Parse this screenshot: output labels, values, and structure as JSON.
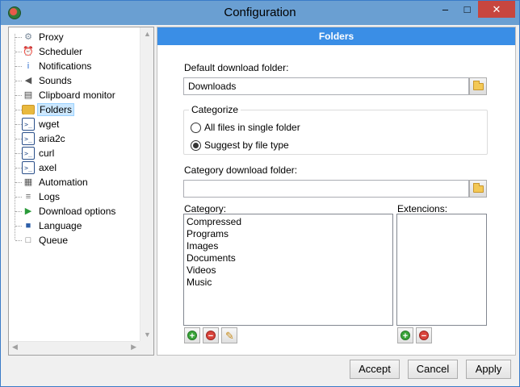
{
  "window": {
    "title": "Configuration",
    "minimize_glyph": "–",
    "maximize_glyph": "□",
    "close_glyph": "✕"
  },
  "tree": {
    "items": [
      {
        "label": "Proxy",
        "icon": "gear-icon",
        "glyph": "⚙",
        "color": "#7a8a9a"
      },
      {
        "label": "Scheduler",
        "icon": "clock-icon",
        "glyph": "⏰",
        "color": "#3a7bc8"
      },
      {
        "label": "Notifications",
        "icon": "info-icon",
        "glyph": "i",
        "color": "#2e6fd0"
      },
      {
        "label": "Sounds",
        "icon": "speaker-icon",
        "glyph": "◀",
        "color": "#555555"
      },
      {
        "label": "Clipboard monitor",
        "icon": "clipboard-icon",
        "glyph": "▤",
        "color": "#444444"
      },
      {
        "label": "Folders",
        "icon": "folder-icon",
        "glyph": "▬",
        "color": "#e9b93e"
      },
      {
        "label": "wget",
        "icon": "console-icon",
        "glyph": ">_",
        "color": "#2a4f8a"
      },
      {
        "label": "aria2c",
        "icon": "console-icon",
        "glyph": ">_",
        "color": "#2a4f8a"
      },
      {
        "label": "curl",
        "icon": "console-icon",
        "glyph": ">_",
        "color": "#2a4f8a"
      },
      {
        "label": "axel",
        "icon": "console-icon",
        "glyph": ">_",
        "color": "#2a4f8a"
      },
      {
        "label": "Automation",
        "icon": "chip-icon",
        "glyph": "▦",
        "color": "#555555"
      },
      {
        "label": "Logs",
        "icon": "document-icon",
        "glyph": "≡",
        "color": "#666666"
      },
      {
        "label": "Download options",
        "icon": "play-download-icon",
        "glyph": "▶",
        "color": "#2a9a3a"
      },
      {
        "label": "Language",
        "icon": "book-icon",
        "glyph": "■",
        "color": "#2e5fa8"
      },
      {
        "label": "Queue",
        "icon": "pages-icon",
        "glyph": "□",
        "color": "#666666"
      }
    ],
    "selected_index": 5
  },
  "panel": {
    "header": "Folders",
    "default_folder_label": "Default download folder:",
    "default_folder_value": "Downloads",
    "categorize_title": "Categorize",
    "radio_single": "All files in single folder",
    "radio_by_type": "Suggest by file type",
    "radio_selected": "by_type",
    "category_folder_label": "Category download folder:",
    "category_folder_value": "",
    "category_label": "Category:",
    "extensions_label": "Extencions:",
    "categories": [
      "Compressed",
      "Programs",
      "Images",
      "Documents",
      "Videos",
      "Music"
    ],
    "extensions": []
  },
  "footer": {
    "accept": "Accept",
    "cancel": "Cancel",
    "apply": "Apply"
  }
}
